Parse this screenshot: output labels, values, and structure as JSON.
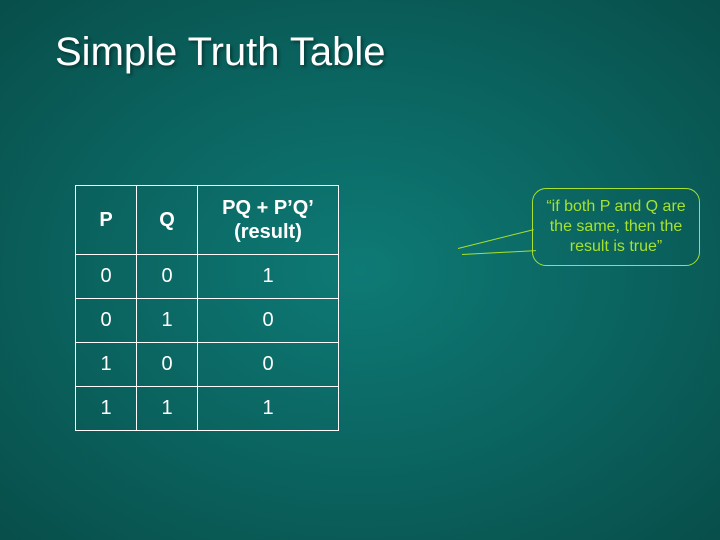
{
  "title": "Simple Truth Table",
  "table": {
    "headers": {
      "p": "P",
      "q": "Q",
      "result_line1": "PQ + P’Q’",
      "result_line2": "(result)"
    },
    "rows": [
      {
        "p": "0",
        "q": "0",
        "result": "1"
      },
      {
        "p": "0",
        "q": "1",
        "result": "0"
      },
      {
        "p": "1",
        "q": "0",
        "result": "0"
      },
      {
        "p": "1",
        "q": "1",
        "result": "1"
      }
    ]
  },
  "callout": {
    "text": "“if both P and Q are the same, then the result is true”"
  }
}
